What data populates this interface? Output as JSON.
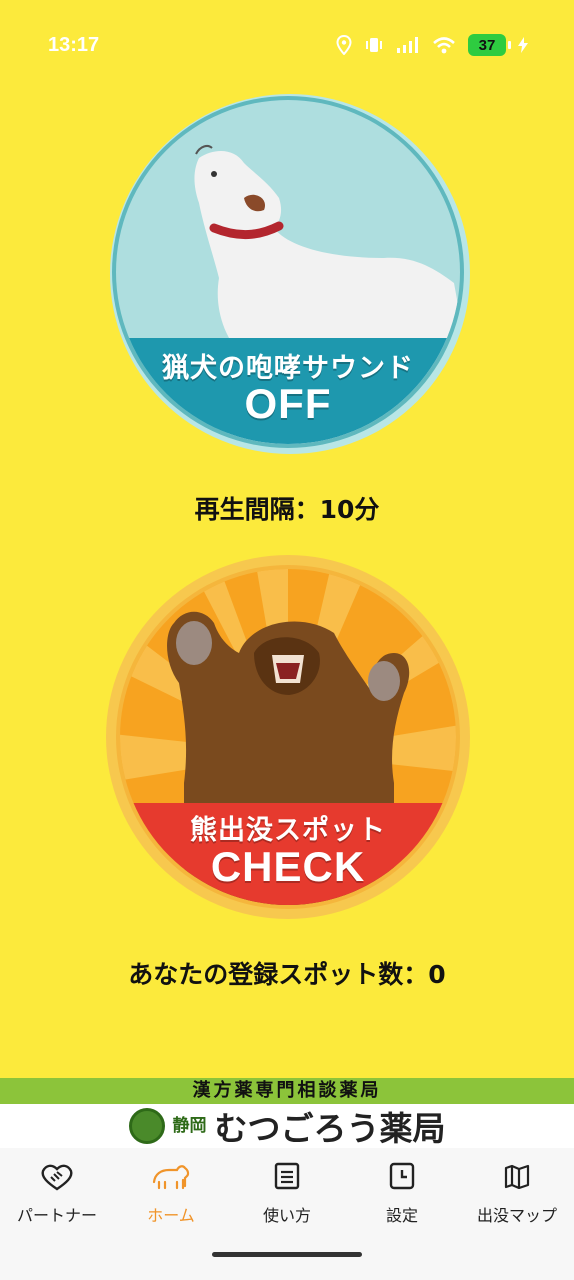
{
  "status": {
    "time": "13:17",
    "battery": "37",
    "icons": [
      "location-icon",
      "vibrate-icon",
      "signal-icon",
      "wifi-icon",
      "battery-icon",
      "charging-icon"
    ]
  },
  "dog_button": {
    "title": "猟犬の咆哮サウンド",
    "state": "OFF",
    "colors": {
      "ring": "#5FB8BE",
      "sky": "#AEDEDF",
      "band": "#1E98AE"
    }
  },
  "interval": {
    "text": "再生間隔：10分"
  },
  "bear_button": {
    "title": "熊出没スポット",
    "state": "CHECK",
    "colors": {
      "ring": "#F5B63C",
      "rays": "#F7A320",
      "band": "#E63A2E"
    }
  },
  "spots": {
    "text": "あなたの登録スポット数：0"
  },
  "banner": {
    "top": "漢方薬専門相談薬局",
    "small": "静岡",
    "name": "むつごろう薬局"
  },
  "tabs": [
    {
      "label": "パートナー",
      "icon": "handshake-icon",
      "active": false
    },
    {
      "label": "ホーム",
      "icon": "bear-icon",
      "active": true
    },
    {
      "label": "使い方",
      "icon": "document-icon",
      "active": false
    },
    {
      "label": "設定",
      "icon": "clock-icon",
      "active": false
    },
    {
      "label": "出没マップ",
      "icon": "map-icon",
      "active": false
    }
  ],
  "accent_color": "#F0942A",
  "background_color": "#FCEA3C"
}
